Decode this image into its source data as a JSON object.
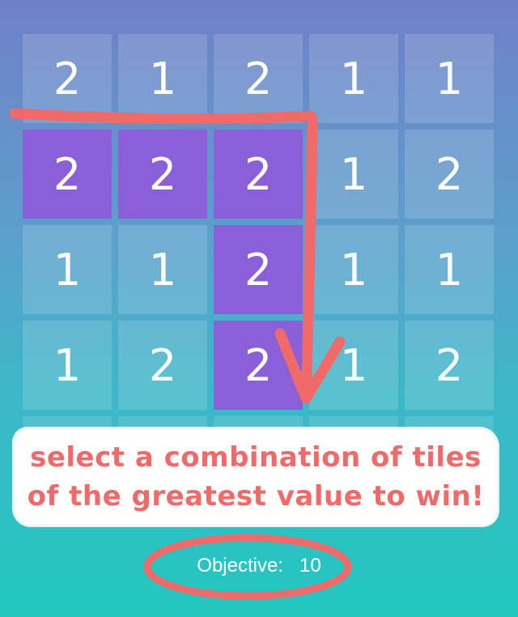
{
  "board": {
    "rows": [
      [
        {
          "value": "2",
          "selected": false
        },
        {
          "value": "1",
          "selected": false
        },
        {
          "value": "2",
          "selected": false
        },
        {
          "value": "1",
          "selected": false
        },
        {
          "value": "1",
          "selected": false
        }
      ],
      [
        {
          "value": "2",
          "selected": true
        },
        {
          "value": "2",
          "selected": true
        },
        {
          "value": "2",
          "selected": true
        },
        {
          "value": "1",
          "selected": false
        },
        {
          "value": "2",
          "selected": false
        }
      ],
      [
        {
          "value": "1",
          "selected": false
        },
        {
          "value": "1",
          "selected": false
        },
        {
          "value": "2",
          "selected": true
        },
        {
          "value": "1",
          "selected": false
        },
        {
          "value": "1",
          "selected": false
        }
      ],
      [
        {
          "value": "1",
          "selected": false
        },
        {
          "value": "2",
          "selected": false
        },
        {
          "value": "2",
          "selected": true
        },
        {
          "value": "1",
          "selected": false
        },
        {
          "value": "2",
          "selected": false
        }
      ],
      [
        {
          "value": "",
          "selected": false
        },
        {
          "value": "",
          "selected": false
        },
        {
          "value": "",
          "selected": false
        },
        {
          "value": "",
          "selected": false
        },
        {
          "value": "",
          "selected": false
        }
      ]
    ]
  },
  "tutorial": {
    "line1": "select a combination of tiles",
    "line2": "of the greatest value to win!"
  },
  "objective": {
    "label": "Objective:",
    "value": "10"
  },
  "colors": {
    "selected_tile": "#8a5fd8",
    "annotation": "#f06a6a",
    "text": "#ffffff"
  }
}
